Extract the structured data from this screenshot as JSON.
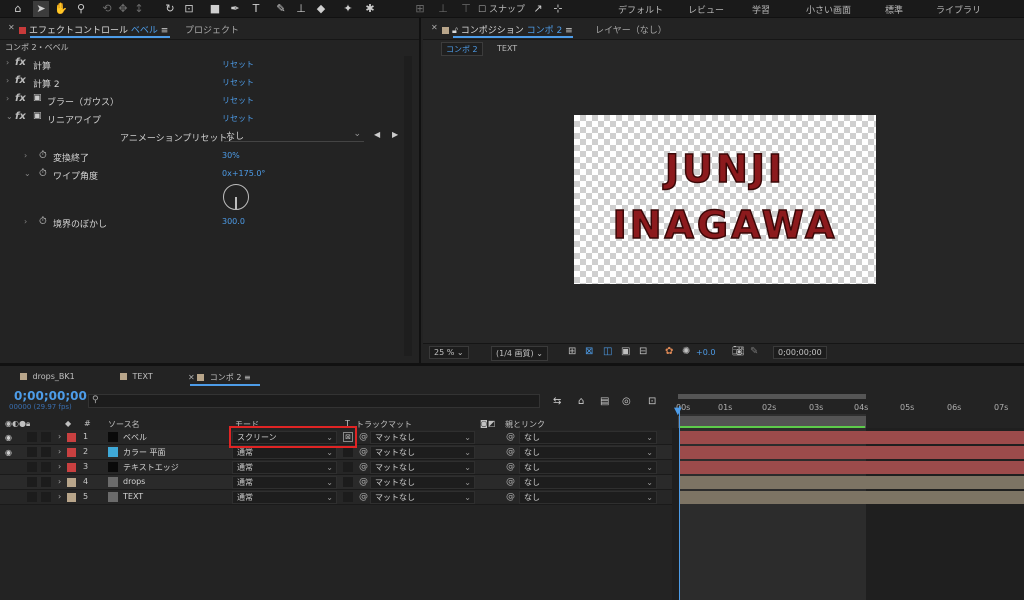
{
  "toolbar": {
    "snap_label": "スナップ",
    "workspaces": [
      "デフォルト",
      "レビュー",
      "学習",
      "小さい画面",
      "標準",
      "ライブラリ"
    ]
  },
  "effects_panel": {
    "tab_prefix": "エフェクトコントロール",
    "tab_layer": "ベベル",
    "project_tab": "プロジェクト",
    "subtitle": "コンポ 2・ベベル",
    "effects": [
      {
        "name": "計算",
        "reset": "リセット"
      },
      {
        "name": "計算 2",
        "reset": "リセット"
      },
      {
        "name": "ブラー（ガウス）",
        "reset": "リセット"
      },
      {
        "name": "リニアワイプ",
        "reset": "リセット"
      }
    ],
    "preset_label": "アニメーションプリセット：",
    "preset_value": "なし",
    "params": [
      {
        "name": "変換終了",
        "value": "30%"
      },
      {
        "name": "ワイプ角度",
        "value": "0x+175.0°"
      },
      {
        "name": "境界のぼかし",
        "value": "300.0"
      }
    ]
  },
  "comp_panel": {
    "tab_prefix": "コンポジション",
    "tab_comp": "コンポ 2",
    "layer_tab": "レイヤー（なし）",
    "sub_tabs": [
      "コンポ 2",
      "TEXT"
    ],
    "logo_line1": "JUNJI",
    "logo_line2": "INAGAWA",
    "zoom": "25 %",
    "resolution": "(1/4 画質)",
    "exposure": "+0.0",
    "timecode": "0;00;00;00"
  },
  "timeline": {
    "tabs": [
      "drops_BK1",
      "TEXT",
      "コンポ 2"
    ],
    "timecode": "0;00;00;00",
    "fps": "00000 (29.97 fps)",
    "col_source": "ソース名",
    "col_mode": "モード",
    "col_t": "T",
    "col_track": "トラックマット",
    "col_parent": "親とリンク",
    "time_ticks": [
      "00s",
      "01s",
      "02s",
      "03s",
      "04s",
      "05s",
      "06s",
      "07s"
    ],
    "layers": [
      {
        "num": "1",
        "name": "ベベル",
        "mode": "スクリーン",
        "track": "マットなし",
        "parent": "なし",
        "label_color": "#c94040",
        "thumb": "#0a0a0a",
        "bar_color": "#9c4b4b"
      },
      {
        "num": "2",
        "name": "カラー 平面",
        "mode": "通常",
        "track": "マットなし",
        "parent": "なし",
        "label_color": "#c94040",
        "thumb": "#3fa9d8",
        "bar_color": "#9c4b4b"
      },
      {
        "num": "3",
        "name": "テキストエッジ",
        "mode": "通常",
        "track": "マットなし",
        "parent": "なし",
        "label_color": "#c94040",
        "thumb": "#0a0a0a",
        "bar_color": "#9c4b4b"
      },
      {
        "num": "4",
        "name": "drops",
        "mode": "通常",
        "track": "マットなし",
        "parent": "なし",
        "label_color": "#b8a58a",
        "thumb": "#6b6b6b",
        "bar_color": "#7d7464"
      },
      {
        "num": "5",
        "name": "TEXT",
        "mode": "通常",
        "track": "マットなし",
        "parent": "なし",
        "label_color": "#b8a58a",
        "thumb": "#6b6b6b",
        "bar_color": "#7d7464"
      }
    ]
  }
}
